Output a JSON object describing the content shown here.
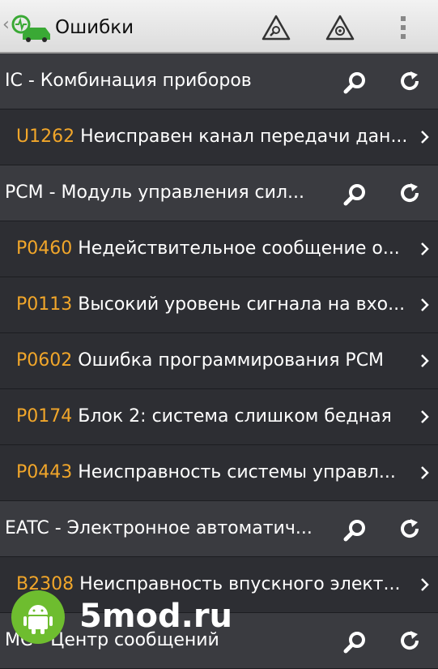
{
  "appbar": {
    "title": "Ошибки",
    "back_glyph": "‹",
    "logo_icon": "car-diagnostics-logo-icon",
    "actions": [
      {
        "icon": "warning-search-icon"
      },
      {
        "icon": "warning-clear-icon"
      },
      {
        "icon": "overflow-menu-icon"
      }
    ]
  },
  "list": {
    "rows": [
      {
        "type": "header",
        "label": "IC - Комбинация приборов"
      },
      {
        "type": "item",
        "code": "U1262",
        "desc": "Неисправен канал передачи дан..."
      },
      {
        "type": "header",
        "label": "PCM - Модуль управления сил..."
      },
      {
        "type": "item",
        "code": "P0460",
        "desc": "Недействительное сообщение о..."
      },
      {
        "type": "item",
        "code": "P0113",
        "desc": "Высокий уровень сигнала на вхо..."
      },
      {
        "type": "item",
        "code": "P0602",
        "desc": "Ошибка программирования PCM"
      },
      {
        "type": "item",
        "code": "P0174",
        "desc": "Блок 2: система слишком бедная"
      },
      {
        "type": "item",
        "code": "P0443",
        "desc": "Неисправность системы управл..."
      },
      {
        "type": "header",
        "label": "EATC - Электронное автоматич..."
      },
      {
        "type": "item",
        "code": "B2308",
        "desc": "Неисправность впускного элект..."
      },
      {
        "type": "header",
        "label": "MC - Центр сообщений"
      }
    ]
  },
  "watermark": {
    "text": "5mod.ru",
    "icon": "android-icon"
  },
  "colors": {
    "code": "#f1a62a",
    "header_bg": "#3a3b40",
    "item_bg": "#2d2e33",
    "brand_green": "#6ebd2f"
  }
}
